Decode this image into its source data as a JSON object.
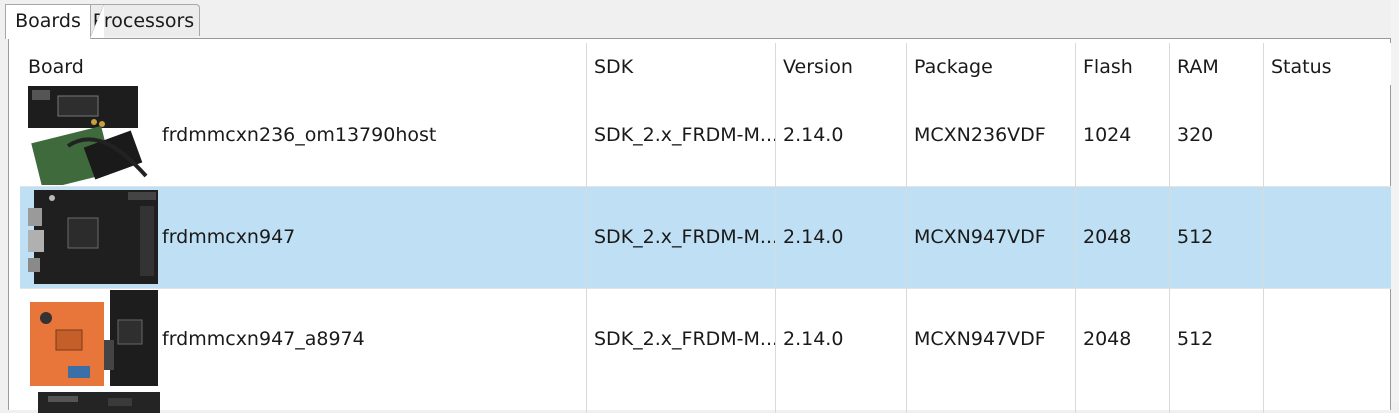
{
  "tabs": [
    {
      "label": "Boards",
      "active": true
    },
    {
      "label": "Processors",
      "active": false
    }
  ],
  "table": {
    "columns": [
      "Board",
      "SDK",
      "Version",
      "Package",
      "Flash",
      "RAM",
      "Status"
    ],
    "rows": [
      {
        "board": "frdmmcxn236_om13790host",
        "sdk": "SDK_2.x_FRDM-M...",
        "version": "2.14.0",
        "package": "MCXN236VDF",
        "flash": "1024",
        "ram": "320",
        "status": "",
        "selected": false
      },
      {
        "board": "frdmmcxn947",
        "sdk": "SDK_2.x_FRDM-M...",
        "version": "2.14.0",
        "package": "MCXN947VDF",
        "flash": "2048",
        "ram": "512",
        "status": "",
        "selected": true
      },
      {
        "board": "frdmmcxn947_a8974",
        "sdk": "SDK_2.x_FRDM-M...",
        "version": "2.14.0",
        "package": "MCXN947VDF",
        "flash": "2048",
        "ram": "512",
        "status": "",
        "selected": false
      }
    ]
  },
  "colors": {
    "selected_row": "#bfe0f4",
    "board_pcb_dark": "#1d1d1d",
    "board_pcb_orange": "#e8763a",
    "board_pcb_green": "#3f6b3c"
  }
}
